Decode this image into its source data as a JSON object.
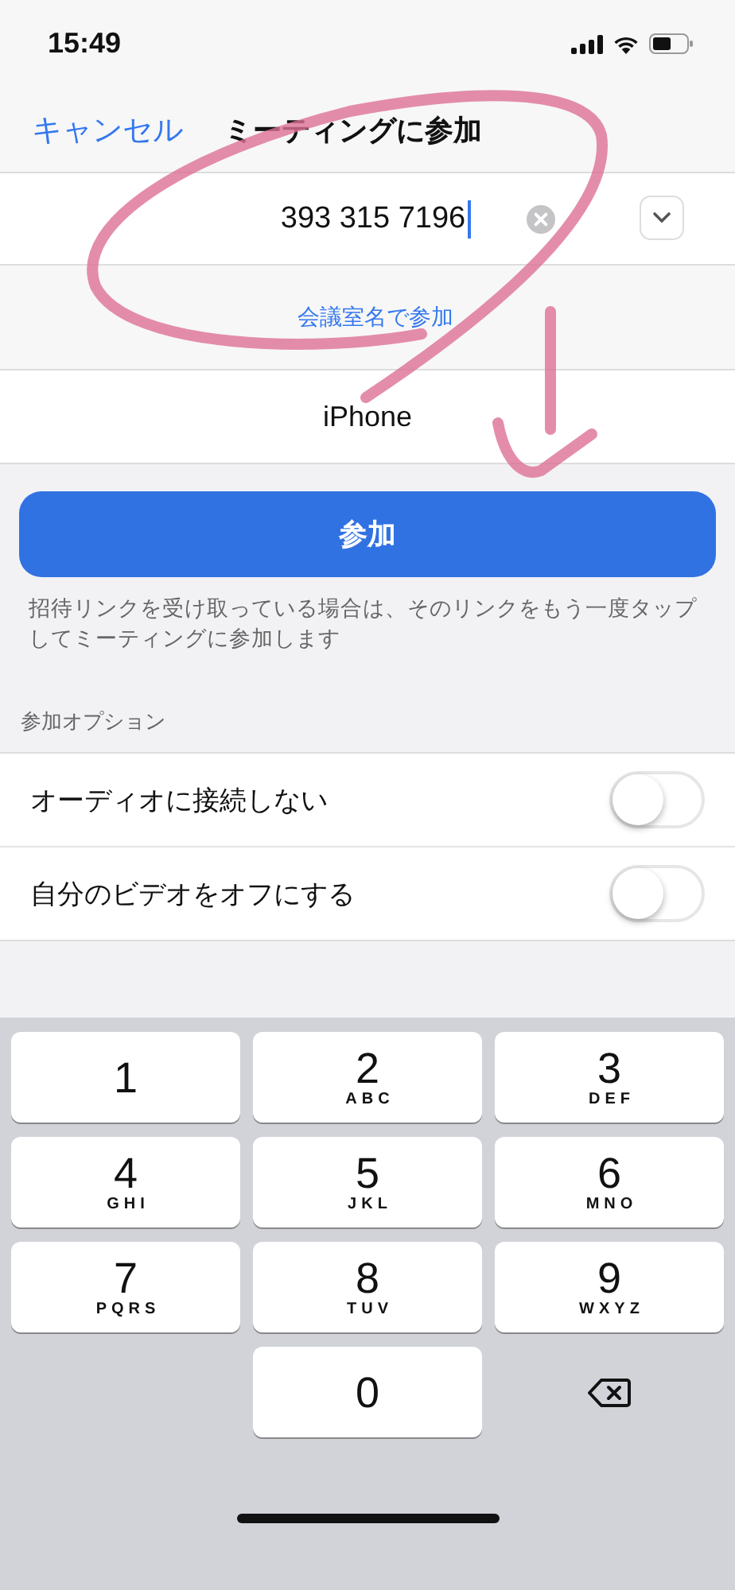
{
  "status_bar": {
    "time": "15:49"
  },
  "nav": {
    "cancel": "キャンセル",
    "title": "ミーティングに参加"
  },
  "meeting_id": {
    "value": "393 315 7196",
    "focused": true
  },
  "room_name_link": "会議室名で参加",
  "display_name": {
    "value": "iPhone"
  },
  "join_button": "参加",
  "hint": "招待リンクを受け取っている場合は、そのリンクをもう一度タップしてミーティングに参加します",
  "options_header": "参加オプション",
  "options": [
    {
      "label": "オーディオに接続しない",
      "on": false
    },
    {
      "label": "自分のビデオをオフにする",
      "on": false
    }
  ],
  "keypad": [
    {
      "kind": "digit",
      "digit": "1"
    },
    {
      "kind": "digit",
      "digit": "2",
      "letters": "ABC"
    },
    {
      "kind": "digit",
      "digit": "3",
      "letters": "DEF"
    },
    {
      "kind": "digit",
      "digit": "4",
      "letters": "GHI"
    },
    {
      "kind": "digit",
      "digit": "5",
      "letters": "JKL"
    },
    {
      "kind": "digit",
      "digit": "6",
      "letters": "MNO"
    },
    {
      "kind": "digit",
      "digit": "7",
      "letters": "PQRS"
    },
    {
      "kind": "digit",
      "digit": "8",
      "letters": "TUV"
    },
    {
      "kind": "digit",
      "digit": "9",
      "letters": "WXYZ"
    },
    {
      "kind": "blank"
    },
    {
      "kind": "digit",
      "digit": "0"
    },
    {
      "kind": "delete"
    }
  ]
}
